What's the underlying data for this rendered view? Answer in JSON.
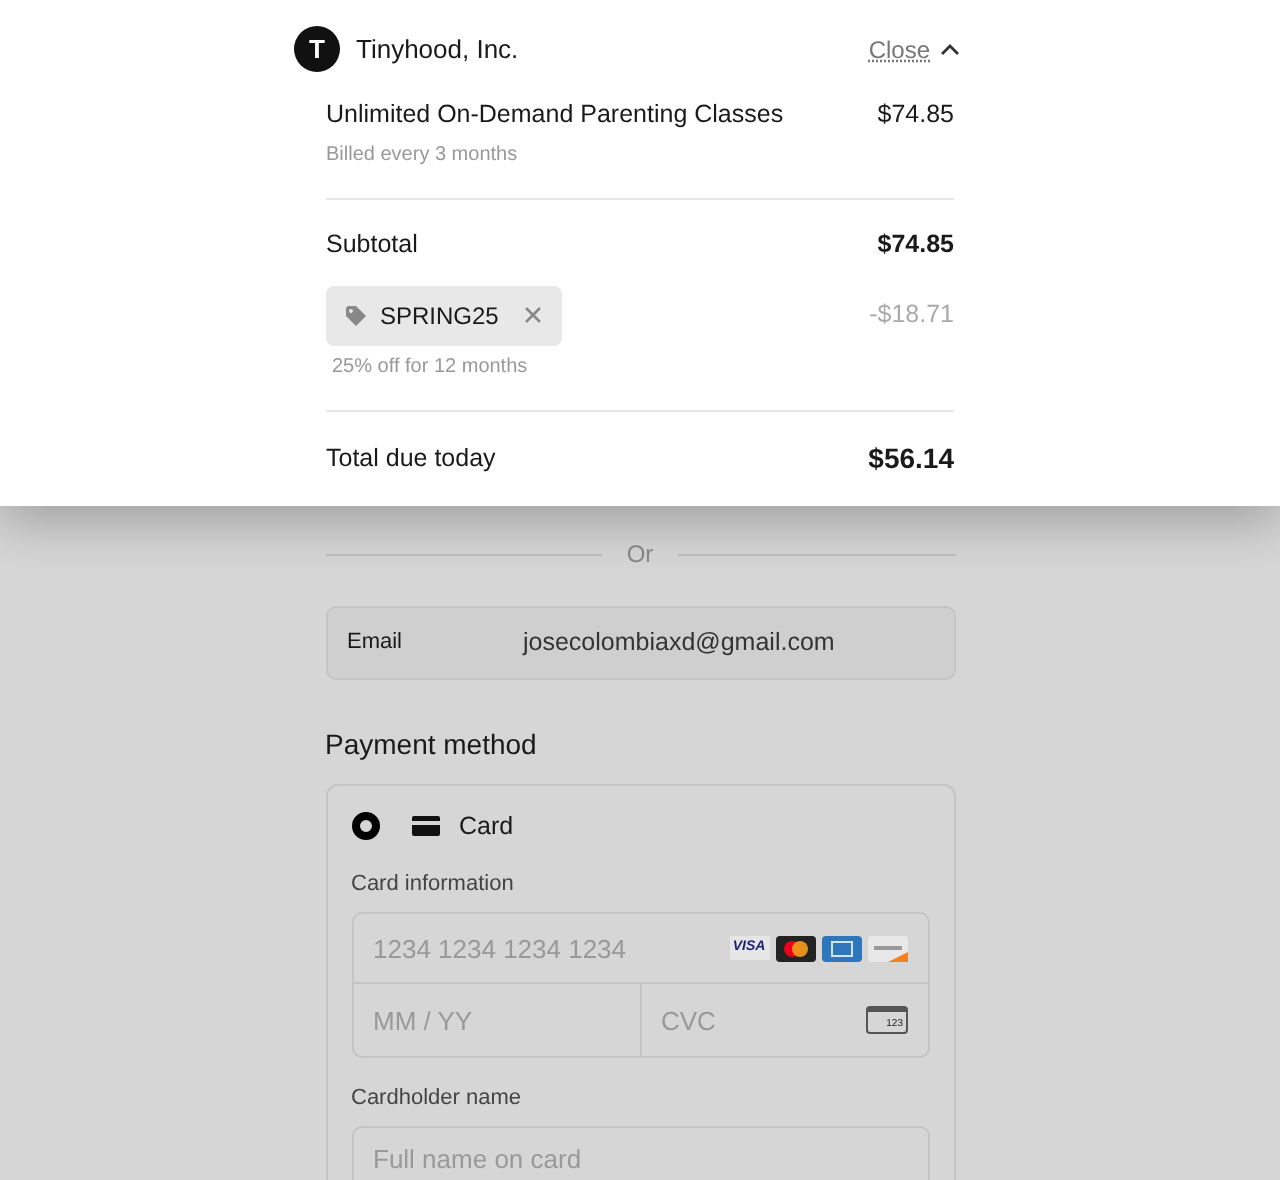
{
  "merchant": {
    "name": "Tinyhood, Inc.",
    "logo_letter": "T",
    "close_label": "Close",
    "expanded": true
  },
  "line_items": [
    {
      "name": "Unlimited On-Demand Parenting Classes",
      "note": "Billed every 3 months",
      "price": "$74.85"
    }
  ],
  "subtotal": {
    "label": "Subtotal",
    "value": "$74.85"
  },
  "promo": {
    "code": "SPRING25",
    "note": "25% off for 12 months",
    "value": "-$18.71"
  },
  "total": {
    "label": "Total due today",
    "value": "$56.14"
  },
  "divider_label": "Or",
  "email": {
    "label": "Email",
    "value": "josecolombiaxd@gmail.com"
  },
  "payment_method": {
    "title": "Payment method",
    "options": [
      {
        "label": "Card",
        "selected": true
      }
    ]
  },
  "card": {
    "label": "Card information",
    "number_placeholder": "1234 1234 1234 1234",
    "brands": [
      {
        "kind": "visa",
        "label": "VISA"
      },
      {
        "kind": "mastercard"
      },
      {
        "kind": "amex"
      },
      {
        "kind": "discover"
      }
    ],
    "expiry_placeholder": "MM / YY",
    "cvc_placeholder": "CVC",
    "cvc_icon_text": "123"
  },
  "cardholder": {
    "label": "Cardholder name",
    "placeholder": "Full name on card"
  }
}
